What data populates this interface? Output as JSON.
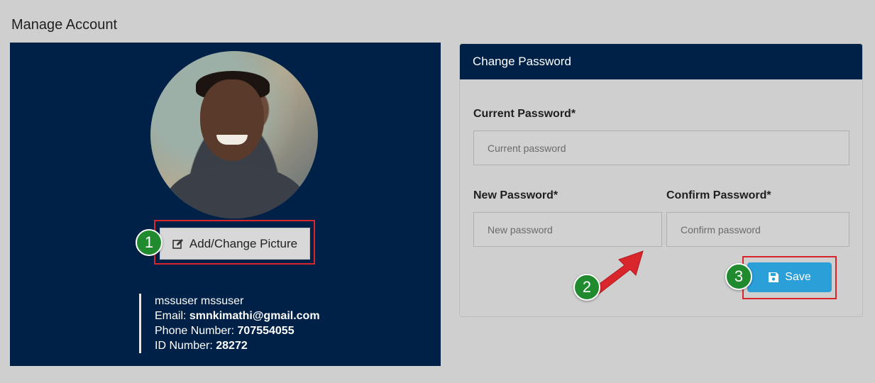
{
  "page": {
    "title": "Manage Account"
  },
  "profile": {
    "change_picture_label": "Add/Change Picture",
    "full_name": "mssuser mssuser",
    "email_label": "Email:",
    "email_value": "smnkimathi@gmail.com",
    "phone_label": "Phone Number:",
    "phone_value": "707554055",
    "id_label": "ID Number:",
    "id_value": "28272"
  },
  "password_card": {
    "title": "Change Password",
    "current_label": "Current Password*",
    "current_placeholder": "Current password",
    "new_label": "New Password*",
    "new_placeholder": "New password",
    "confirm_label": "Confirm Password*",
    "confirm_placeholder": "Confirm password",
    "save_label": "Save"
  },
  "annotations": {
    "step1": "1",
    "step2": "2",
    "step3": "3"
  },
  "colors": {
    "panel": "#002147",
    "accent": "#2a9fd8",
    "highlight": "#d9262c",
    "badge": "#1f8a2e",
    "arrow": "#d9262c"
  },
  "icons": {
    "picture": "edit-icon",
    "save": "floppy-disk-icon",
    "arrow": "arrow-up-right-icon"
  }
}
